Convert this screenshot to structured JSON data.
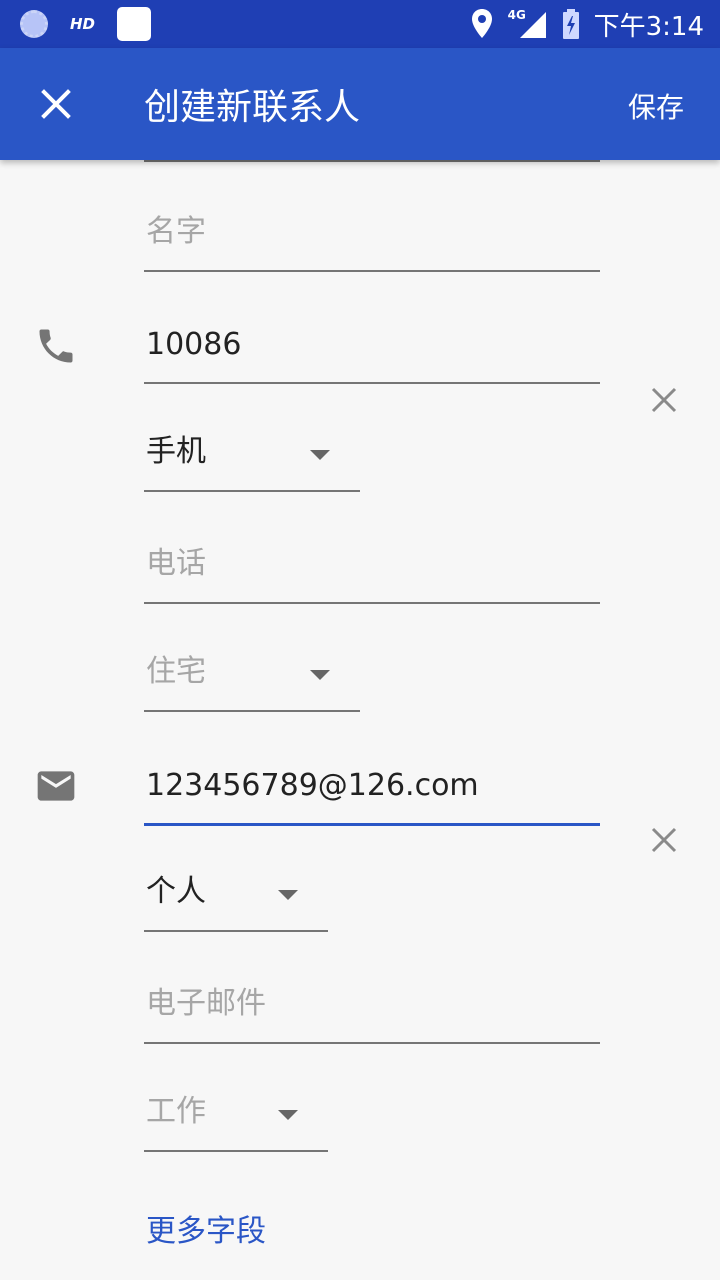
{
  "status_bar": {
    "hd_label": "HD",
    "network_label": "4G",
    "time": "下午3:14"
  },
  "app_bar": {
    "title": "创建新联系人",
    "save_label": "保存",
    "close_icon": "close-icon"
  },
  "form": {
    "name_placeholder": "名字",
    "phone": {
      "value": "10086",
      "type_selected": "手机",
      "new_placeholder": "电话",
      "new_type_selected": "住宅"
    },
    "email": {
      "value": "123456789@126.com",
      "type_selected": "个人",
      "new_placeholder": "电子邮件",
      "new_type_selected": "工作"
    },
    "more_fields_label": "更多字段"
  },
  "colors": {
    "status_bar": "#1f3fb4",
    "app_bar": "#2a56c6",
    "accent": "#2a56c6",
    "background": "#f7f7f7"
  }
}
